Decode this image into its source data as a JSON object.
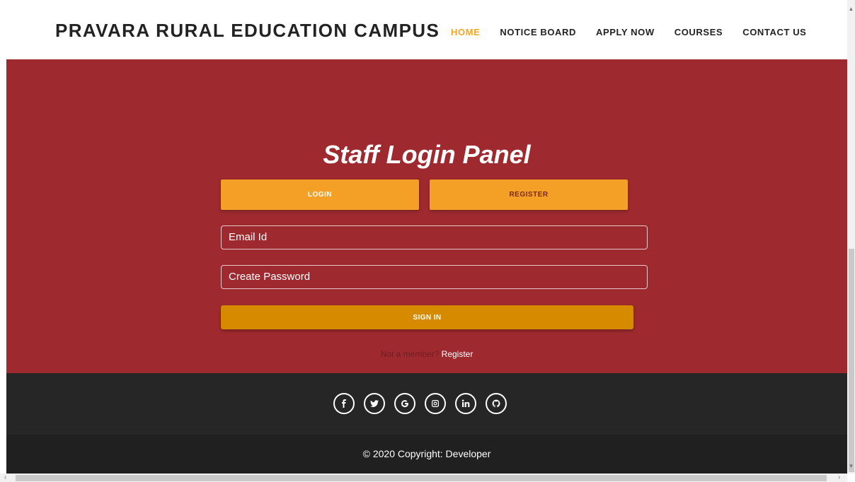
{
  "navbar": {
    "brand": "PRAVARA RURAL EDUCATION CAMPUS",
    "links": [
      "HOME",
      "NOTICE BOARD",
      "APPLY NOW",
      "COURSES",
      "CONTACT US"
    ],
    "active_color": "#f5a623"
  },
  "hero": {
    "title": "Staff Login Panel",
    "tab_login": "LOGIN",
    "tab_register": "REGISTER",
    "email_placeholder": "Email Id",
    "password_placeholder": "Create Password",
    "signin_label": "SIGN IN",
    "member_question": "Not a member?",
    "register_link": "Register",
    "background_color": "#9e2a2f",
    "button_color": "#f49f25"
  },
  "footer": {
    "social_icons": [
      "facebook-icon",
      "twitter-icon",
      "google-icon",
      "instagram-icon",
      "linkedin-icon",
      "github-icon"
    ],
    "copyright": "© 2020 Copyright: Developer"
  }
}
